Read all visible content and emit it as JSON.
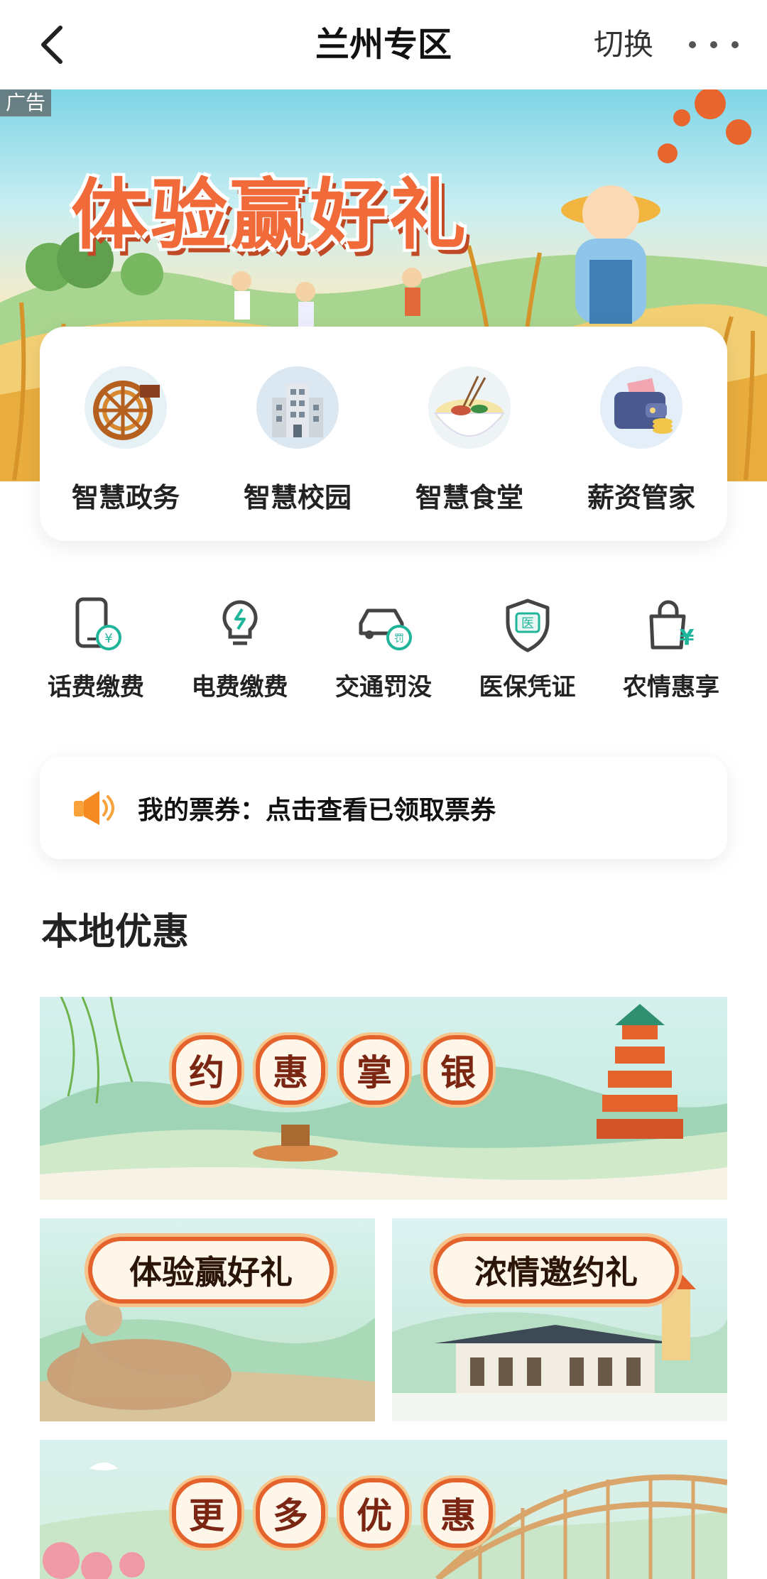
{
  "header": {
    "back_icon": "chevron-left-icon",
    "title": "兰州专区",
    "switch_label": "切换",
    "more_icon": "more-dots-icon"
  },
  "hero_banner": {
    "ad_tag": "广告",
    "headline": "体验赢好礼"
  },
  "quick_entries": [
    {
      "label": "智慧政务",
      "icon": "waterwheel-icon"
    },
    {
      "label": "智慧校园",
      "icon": "school-building-icon"
    },
    {
      "label": "智慧食堂",
      "icon": "noodle-bowl-icon"
    },
    {
      "label": "薪资管家",
      "icon": "wallet-icon"
    }
  ],
  "services": [
    {
      "label": "话费缴费",
      "icon": "phone-bill-icon"
    },
    {
      "label": "电费缴费",
      "icon": "lightbulb-icon"
    },
    {
      "label": "交通罚没",
      "icon": "car-fine-icon"
    },
    {
      "label": "医保凭证",
      "icon": "medical-shield-icon"
    },
    {
      "label": "农情惠享",
      "icon": "shopping-bag-icon"
    }
  ],
  "ticket_notice": {
    "icon": "speaker-icon",
    "text": "我的票券：点击查看已领取票券"
  },
  "section": {
    "title": "本地优惠"
  },
  "promos": {
    "top_chars": [
      "约",
      "惠",
      "掌",
      "银"
    ],
    "left_label": "体验赢好礼",
    "right_label": "浓情邀约礼",
    "bottom_chars": [
      "更",
      "多",
      "优",
      "惠"
    ]
  },
  "colors": {
    "accent_green": "#1fb59a",
    "badge_orange": "#e4622c",
    "hero_title": "#f06a3a"
  }
}
